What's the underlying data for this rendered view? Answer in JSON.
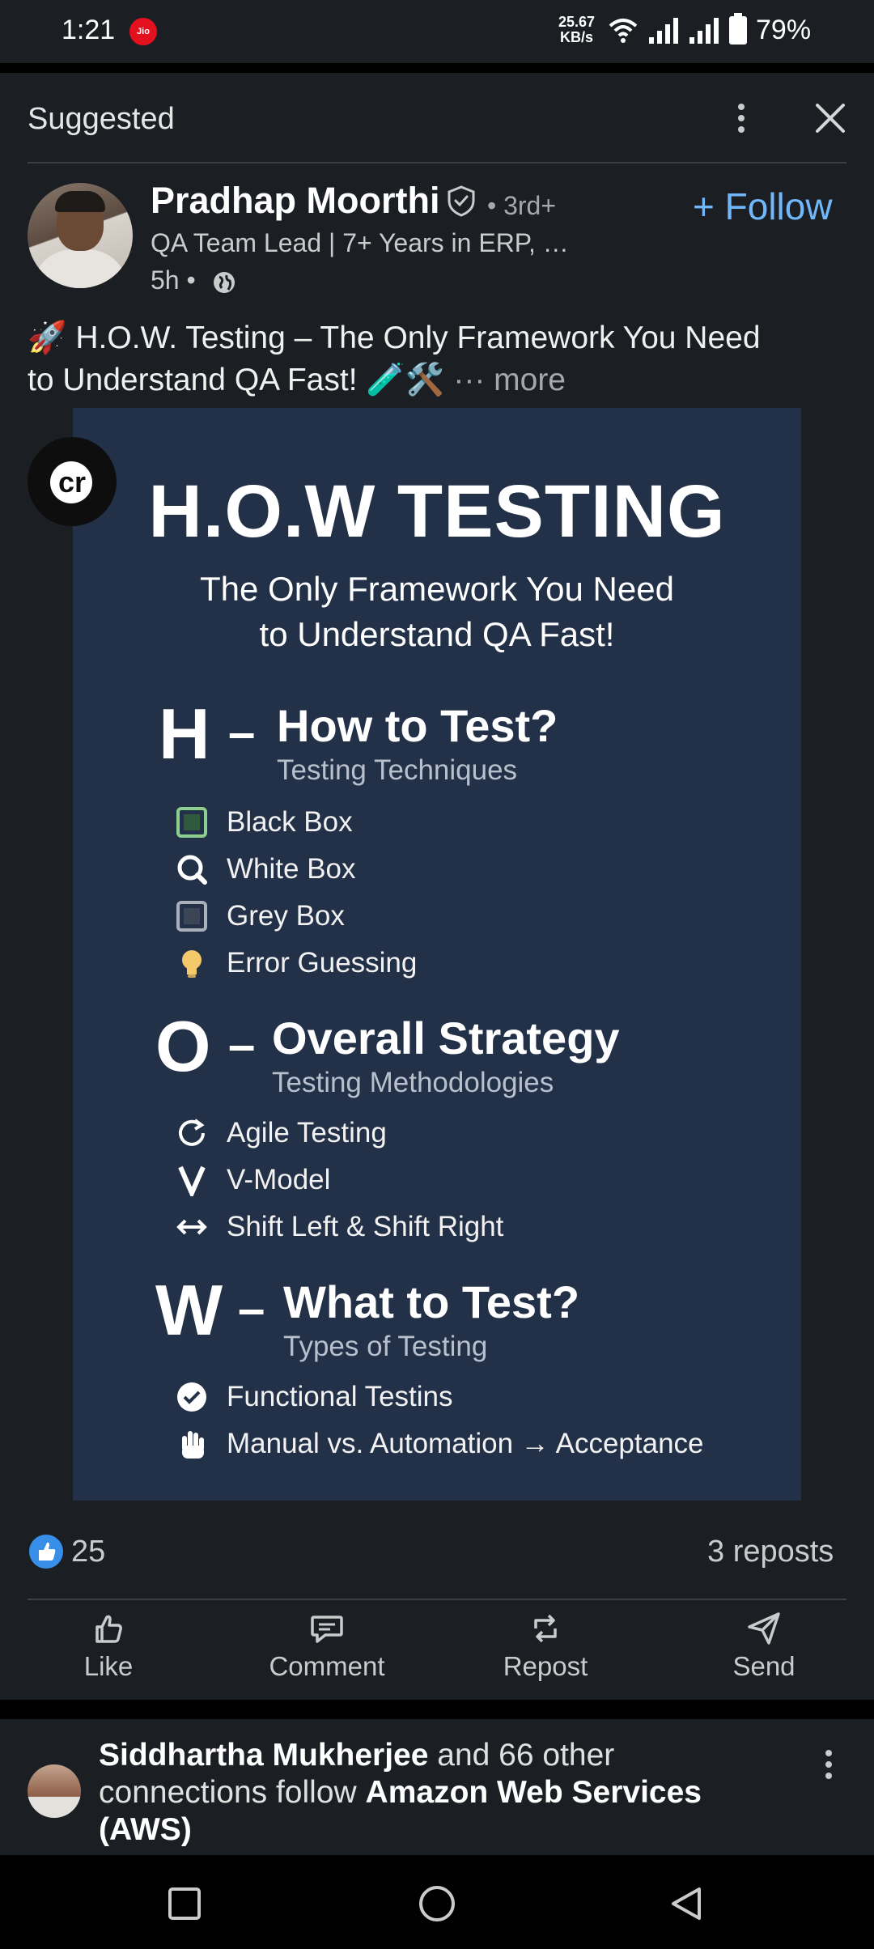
{
  "status_bar": {
    "time": "1:21",
    "carrier_badge": "Jio",
    "net_speed_value": "25.67",
    "net_speed_unit": "KB/s",
    "battery": "79%",
    "icons": [
      "wifi-icon",
      "signal-icon",
      "signal-icon",
      "battery-icon"
    ]
  },
  "feed_header": {
    "label": "Suggested"
  },
  "post": {
    "author": {
      "name": "Pradhap Moorthi",
      "degree": "• 3rd+",
      "headline": "QA Team Lead | 7+ Years in ERP, …",
      "time": "5h •"
    },
    "follow_label": "+ Follow",
    "text_line1": "🚀 H.O.W. Testing – The Only Framework You Need",
    "text_line2": "to Understand QA Fast! 🧪🛠️",
    "more_label": "··· more",
    "graphic": {
      "badge": "cr",
      "title": "H.O.W TESTING",
      "subtitle_line1": "The Only Framework You Need",
      "subtitle_line2": "to Understand QA Fast!",
      "sections": [
        {
          "letter": "H",
          "dash": "–",
          "title": "How to Test?",
          "subtitle": "Testing Techniques",
          "items": [
            "Black Box",
            "White Box",
            "Grey Box",
            "Error Guessing"
          ]
        },
        {
          "letter": "O",
          "dash": "–",
          "title": "Overall Strategy",
          "subtitle": "Testing Methodologies",
          "items": [
            "Agile Testing",
            "V-Model",
            "Shift Left & Shift Right"
          ]
        },
        {
          "letter": "W",
          "dash": "–",
          "title": "What to Test?",
          "subtitle": "Types of Testing",
          "items": [
            "Functional Testins",
            "Manual vs. Automation → Acceptance"
          ]
        }
      ]
    },
    "reactions": {
      "count": "25",
      "reposts": "3 reposts"
    },
    "actions": {
      "like": "Like",
      "comment": "Comment",
      "repost": "Repost",
      "send": "Send"
    }
  },
  "next_card": {
    "person": "Siddhartha Mukherjee",
    "middle": " and 66 other connections follow ",
    "company": "Amazon Web Services (AWS)"
  },
  "colors": {
    "background": "#1b1f23",
    "graphic_bg": "#223048",
    "accent_blue": "#71b7fb",
    "like_blue": "#378fe9"
  }
}
